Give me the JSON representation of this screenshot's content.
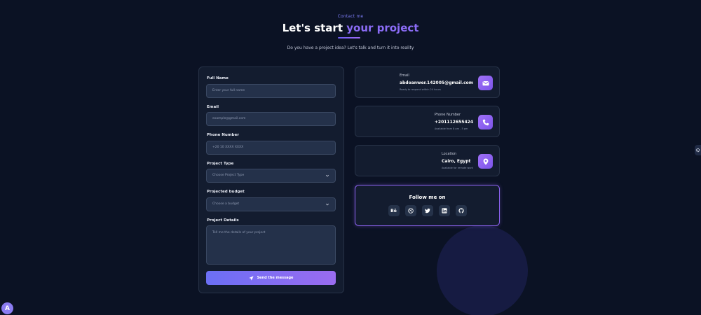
{
  "header": {
    "eyebrow": "Contact me",
    "title_main": "Let's start",
    "title_accent": "your project",
    "subtitle": "Do you have a project idea? Let's talk and turn it into reality"
  },
  "form": {
    "full_name": {
      "label": "Full Name",
      "placeholder": "Enter your full name"
    },
    "email": {
      "label": "Email",
      "placeholder": "example@gmail.com"
    },
    "phone": {
      "label": "Phone Number",
      "placeholder": "+20 10 XXXX XXXX"
    },
    "project_type": {
      "label": "Project Type",
      "value": "Choose Project Type"
    },
    "budget": {
      "label": "Projected budget",
      "value": "Choose a budget"
    },
    "details": {
      "label": "Project Details",
      "placeholder": "Tell me the details of your project"
    },
    "submit_label": "Send the message"
  },
  "contact": {
    "email": {
      "title": "Email",
      "value": "abdoanwer.142005@gmail.com",
      "note": "Ready to respond within 24 hours"
    },
    "phone": {
      "title": "Phone Number",
      "value": "+201112655424",
      "note": "Available from 8 am - 5 pm"
    },
    "location": {
      "title": "Location",
      "value": "Cairo, Egypt",
      "note": "Available for remote work"
    }
  },
  "follow": {
    "title": "Follow me on",
    "socials": [
      {
        "icon": "behance-icon",
        "glyph": "Bē"
      },
      {
        "icon": "dribbble-icon"
      },
      {
        "icon": "twitter-icon"
      },
      {
        "icon": "linkedin-icon"
      },
      {
        "icon": "github-icon"
      }
    ]
  },
  "floating": {
    "logo_letter": "A"
  },
  "colors": {
    "accent": "#8b6cf6",
    "background": "#0b1224",
    "card": "#131c2f"
  }
}
